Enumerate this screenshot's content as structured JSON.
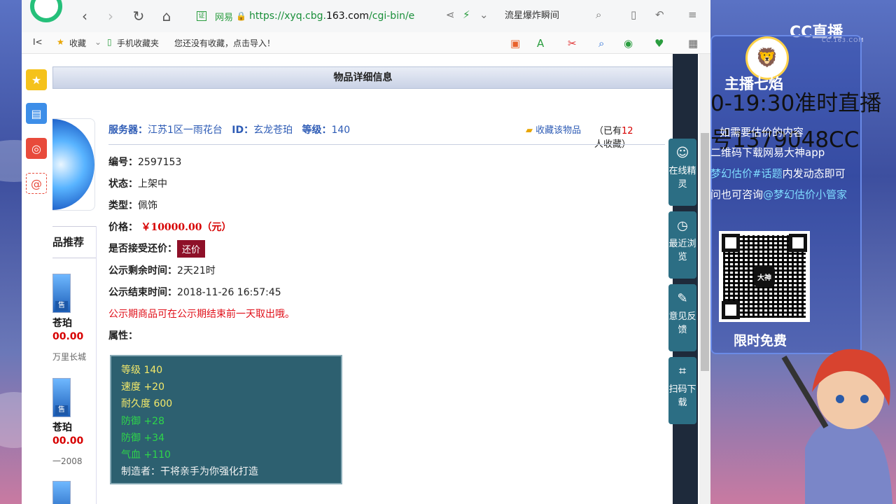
{
  "browser": {
    "nav": {
      "back": "‹",
      "forward": "›",
      "refresh": "↻",
      "home": "⌂"
    },
    "address": {
      "cert": "网易",
      "url_prefix": "https://xyq.cbg.",
      "url_domain": "163.com",
      "url_suffix": "/cgi-bin/e"
    },
    "search_text": "流星爆炸瞬间",
    "bookmarks": {
      "collapse": "I<",
      "favorites": "收藏",
      "mobile": "手机收藏夹",
      "hint": "您还没有收藏，点击导入！"
    }
  },
  "page": {
    "header": "物品详细信息",
    "info": {
      "server_label": "服务器：",
      "server_value": "江苏1区一雨花台",
      "id_label": "ID：",
      "id_value": "玄龙苍珀",
      "level_label": "等级：",
      "level_value": "140",
      "collect": "收藏该物品",
      "collected_pre": "（已有",
      "collected_count": "12",
      "collected_post": "人收藏）"
    },
    "fields": [
      {
        "label": "编号：",
        "value": "2597153"
      },
      {
        "label": "状态：",
        "value": "上架中"
      },
      {
        "label": "类型：",
        "value": "佩饰"
      },
      {
        "label": "价格：",
        "value": "￥10000.00（元）"
      },
      {
        "label": "是否接受还价：",
        "value": "还价"
      },
      {
        "label": "公示剩余时间：",
        "value": "2天21时"
      },
      {
        "label": "公示结束时间：",
        "value": "2018-11-26 16:57:45"
      }
    ],
    "notice": "公示期商品可在公示期结束前一天取出哦。",
    "attr_label": "属性：",
    "attributes": [
      {
        "text": "等级 140",
        "color": "yellow"
      },
      {
        "text": "速度 +20",
        "color": "yellow"
      },
      {
        "text": "耐久度 600",
        "color": "yellow"
      },
      {
        "text": "防御 +28",
        "color": "green"
      },
      {
        "text": "防御 +34",
        "color": "green"
      },
      {
        "text": "气血 +110",
        "color": "green"
      },
      {
        "text": "制造者：干将亲手为你强化打造",
        "color": "white"
      }
    ],
    "recommend": {
      "title": "品推荐",
      "items": [
        {
          "name": "苍珀",
          "price": "00.00",
          "sub": "万里长城",
          "sell": "售"
        },
        {
          "name": "苍珀",
          "price": "00.00",
          "sub": "一2008",
          "sell": "售"
        }
      ]
    }
  },
  "floatbar": [
    {
      "label": "在线精灵",
      "icon": "fairy-icon"
    },
    {
      "label": "最近浏览",
      "icon": "clock-icon"
    },
    {
      "label": "意见反馈",
      "icon": "edit-icon"
    },
    {
      "label": "扫码下载",
      "icon": "scan-icon"
    }
  ],
  "overlay": {
    "brand": "CC直播",
    "brand_sub": "CC.163.COM",
    "host": "主播七焰",
    "line1": "0-19:30准时直播",
    "line2": "号1379048CC",
    "line3": "如需要估价的内容",
    "line4": "二维码下载网易大神app",
    "line5_hl": "梦幻估价#话题",
    "line5_rest": "内发动态即可",
    "line6_pre": "问也可咨询",
    "line6_hl": "@梦幻估价小管家",
    "qr_center": "大神",
    "free": "限时免费"
  },
  "colors": {
    "accent_green": "#25c07a",
    "price_red": "#d70000",
    "bargain_bg": "#8e1028",
    "attr_bg": "#2d6070"
  }
}
